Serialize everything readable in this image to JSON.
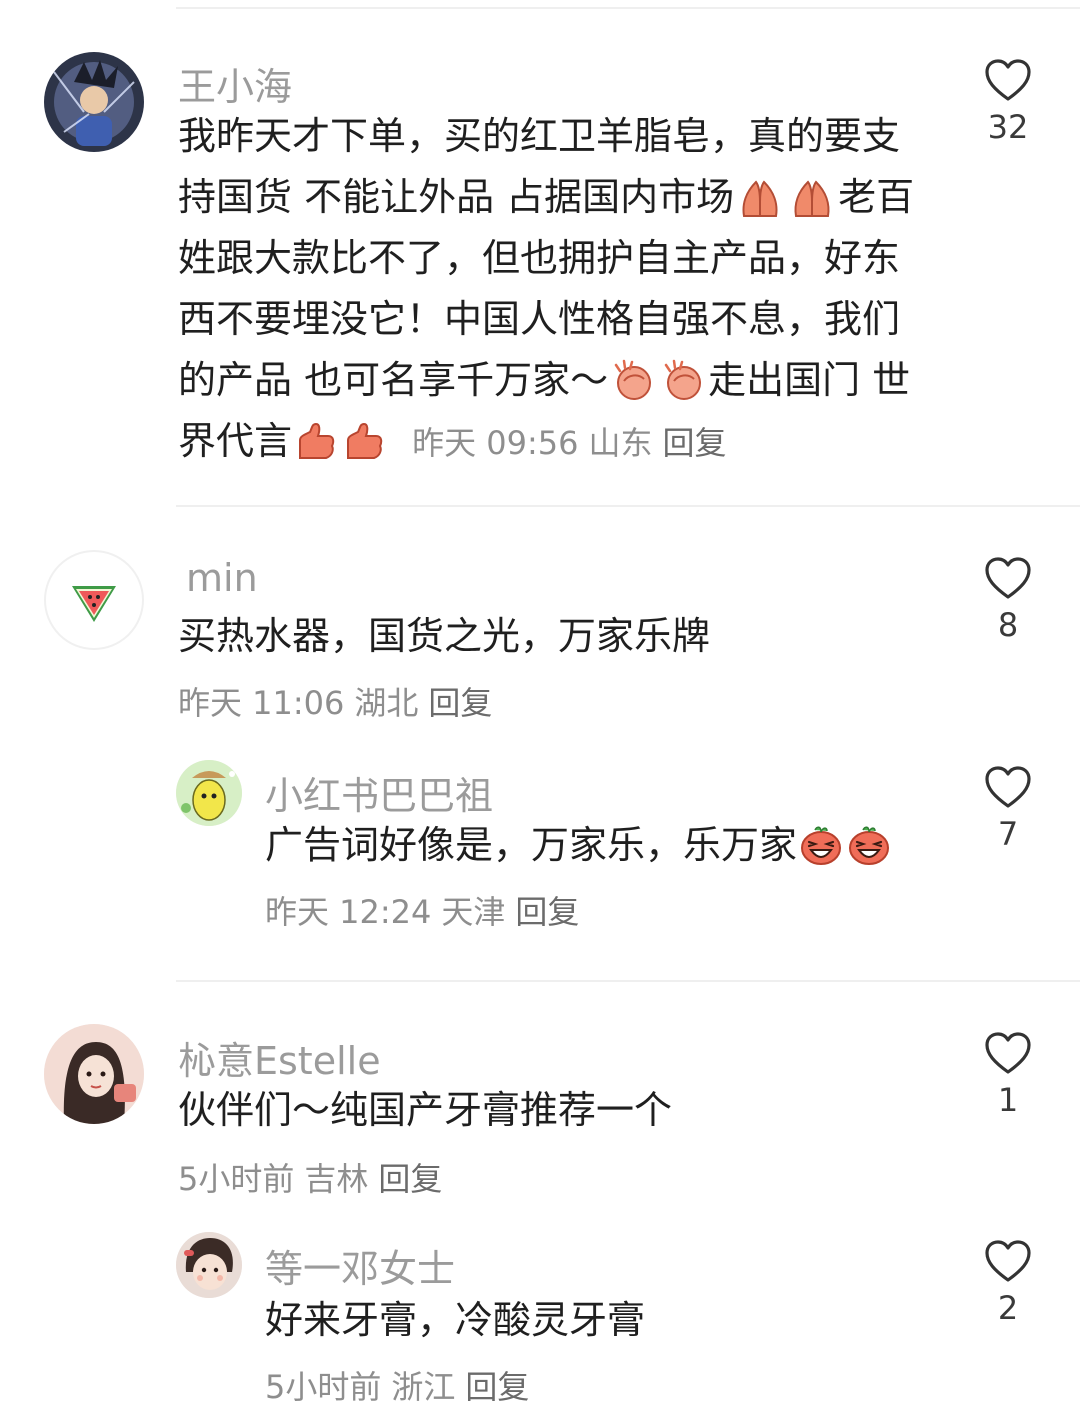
{
  "comments": [
    {
      "name": "王小海",
      "text_parts": [
        "我昨天才下单，买的红卫羊脂皂，真的要支",
        "持国货 不能让外品 占据国内市场",
        "老百",
        "姓跟大款比不了，但也拥护自主产品，好东",
        "西不要埋没它！中国人性格自强不息，我们",
        "的产品 也可名享千万家～",
        "走出国门 世",
        "界代言"
      ],
      "time": "昨天 09:56",
      "location": "山东",
      "reply": "回复",
      "likes": "32"
    },
    {
      "name": "min",
      "text": "买热水器，国货之光，万家乐牌",
      "time": "昨天 11:06",
      "location": "湖北",
      "reply": "回复",
      "likes": "8"
    },
    {
      "name": "小红书巴巴祖",
      "text": "广告词好像是，万家乐，乐万家",
      "time": "昨天 12:24",
      "location": "天津",
      "reply": "回复",
      "likes": "7"
    },
    {
      "name": "杺意Estelle",
      "text": "伙伴们～纯国产牙膏推荐一个",
      "time": "5小时前",
      "location": "吉林",
      "reply": "回复",
      "likes": "1"
    },
    {
      "name": "等一邓女士",
      "text": "好来牙膏，冷酸灵牙膏",
      "time": "5小时前",
      "location": "浙江",
      "reply": "回复",
      "likes": "2"
    }
  ],
  "icons": {
    "like": "heart-outline-icon",
    "emoji_pray": "pray-hands-emoji",
    "emoji_clap": "clapping-hands-emoji",
    "emoji_thumb": "thumbs-up-emoji",
    "emoji_laugh": "laughing-face-emoji"
  },
  "colors": {
    "name": "#9b9b9b",
    "text": "#1f1f1f",
    "meta": "#8e8e8e",
    "divider": "#efefef"
  }
}
